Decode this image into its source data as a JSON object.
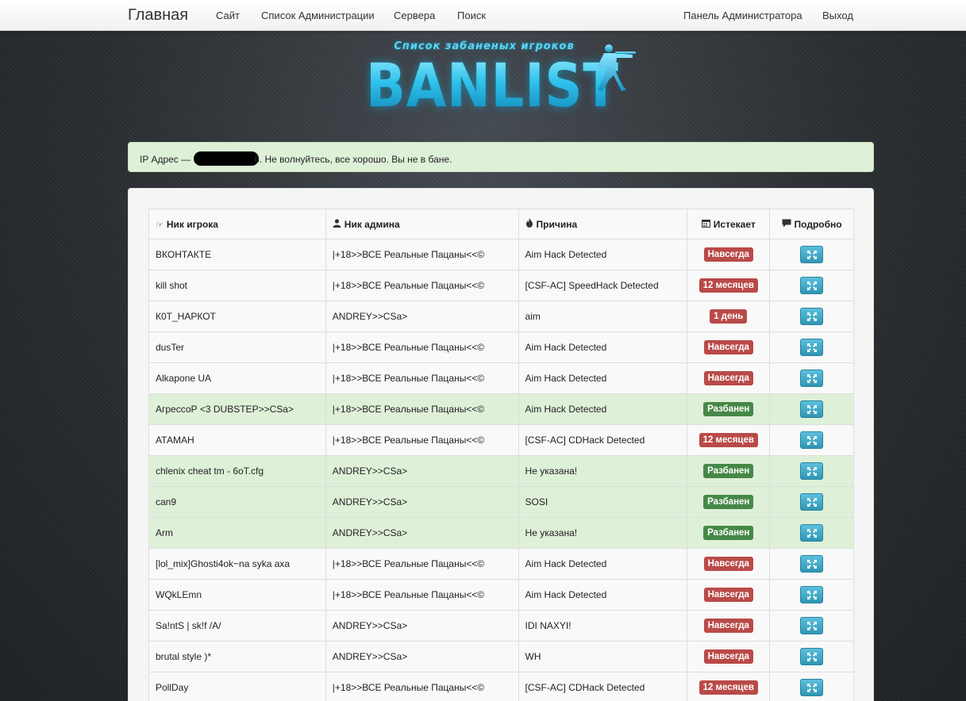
{
  "nav": {
    "brand": "Главная",
    "items": [
      "Сайт",
      "Список Администрации",
      "Сервера",
      "Поиск"
    ],
    "right_items": [
      "Панель Администратора",
      "Выход"
    ]
  },
  "logo": {
    "subtitle": "Список забаненых игроков",
    "title": "BANLIST"
  },
  "alert": {
    "prefix": "IP Адрес — 9",
    "suffix": "6. Не волнуйтесь, все хорошо. Вы не в бане."
  },
  "table": {
    "headers": {
      "player": "Ник игрока",
      "admin": "Ник админа",
      "reason": "Причина",
      "expires": "Истекает",
      "details": "Подробно"
    },
    "rows": [
      {
        "player": "ВКОНТАКТЕ",
        "admin": "|+18>>ВСЕ Реальные Пацаны<<©",
        "reason": "Aim Hack Detected",
        "expires": "Навсегда",
        "status": "danger"
      },
      {
        "player": "kill shot",
        "admin": "|+18>>ВСЕ Реальные Пацаны<<©",
        "reason": "[CSF-AC] SpeedHack Detected",
        "expires": "12 месяцев",
        "status": "danger"
      },
      {
        "player": "К0Т_НАРКОТ",
        "admin": "ANDREY>>CSa>",
        "reason": "aim",
        "expires": "1 день",
        "status": "danger"
      },
      {
        "player": "dusTer",
        "admin": "|+18>>ВСЕ Реальные Пацаны<<©",
        "reason": "Aim Hack Detected",
        "expires": "Навсегда",
        "status": "danger"
      },
      {
        "player": "Alkapone UA",
        "admin": "|+18>>ВСЕ Реальные Пацаны<<©",
        "reason": "Aim Hack Detected",
        "expires": "Навсегда",
        "status": "danger"
      },
      {
        "player": "АгрессоР <3 DUBSTEP>>CSa>",
        "admin": "|+18>>ВСЕ Реальные Пацаны<<©",
        "reason": "Aim Hack Detected",
        "expires": "Разбанен",
        "status": "success"
      },
      {
        "player": "АТАМАН",
        "admin": "|+18>>ВСЕ Реальные Пацаны<<©",
        "reason": "[CSF-AC] CDHack Detected",
        "expires": "12 месяцев",
        "status": "danger"
      },
      {
        "player": "chlenix cheat tm - 6oT.cfg",
        "admin": "ANDREY>>CSa>",
        "reason": "Не указана!",
        "expires": "Разбанен",
        "status": "success"
      },
      {
        "player": "can9",
        "admin": "ANDREY>>CSa>",
        "reason": "SOSI",
        "expires": "Разбанен",
        "status": "success"
      },
      {
        "player": "Arm",
        "admin": "ANDREY>>CSa>",
        "reason": "Не указана!",
        "expires": "Разбанен",
        "status": "success"
      },
      {
        "player": "[lol_mix]Ghosti4ok~na syka axa",
        "admin": "|+18>>ВСЕ Реальные Пацаны<<©",
        "reason": "Aim Hack Detected",
        "expires": "Навсегда",
        "status": "danger"
      },
      {
        "player": "WQkLEmn",
        "admin": "|+18>>ВСЕ Реальные Пацаны<<©",
        "reason": "Aim Hack Detected",
        "expires": "Навсегда",
        "status": "danger"
      },
      {
        "player": "Sa!ntS | sk!f /A/",
        "admin": "ANDREY>>CSa>",
        "reason": "IDI NAXYI!",
        "expires": "Навсегда",
        "status": "danger"
      },
      {
        "player": "brutal style )*",
        "admin": "ANDREY>>CSa>",
        "reason": "WH",
        "expires": "Навсегда",
        "status": "danger"
      },
      {
        "player": "PollDay",
        "admin": "|+18>>ВСЕ Реальные Пацаны<<©",
        "reason": "[CSF-AC] CDHack Detected",
        "expires": "12 месяцев",
        "status": "danger"
      }
    ]
  },
  "colors": {
    "danger": "#b94a48",
    "success": "#468847",
    "info": "#2f96b4",
    "logo": "#1fb9e3",
    "alert_bg": "#dff0d8"
  },
  "icons": {
    "player": "hand-pointing-icon",
    "admin": "user-icon",
    "reason": "fire-icon",
    "expires": "calendar-icon",
    "details": "comment-icon",
    "row_action": "fullscreen-icon"
  }
}
